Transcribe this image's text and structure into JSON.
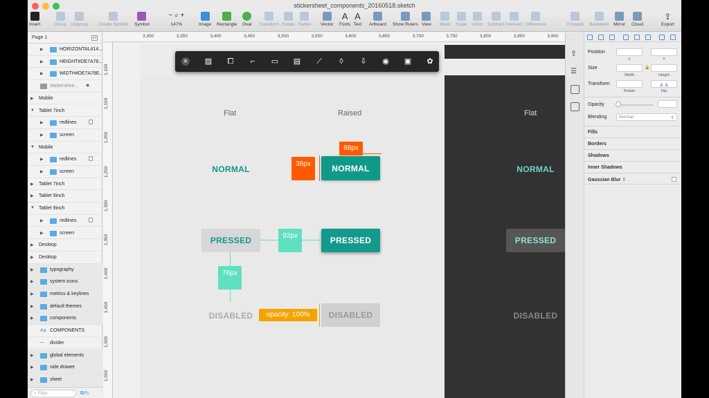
{
  "window": {
    "title": "stickersheet_components_20160518.sketch"
  },
  "toolbar": [
    {
      "id": "insert",
      "label": "Insert",
      "icon": "plus-icon"
    },
    {
      "id": "group",
      "label": "Group",
      "icon": "group-icon"
    },
    {
      "id": "ungroup",
      "label": "Ungroup",
      "icon": "ungroup-icon"
    },
    {
      "id": "create-symbol",
      "label": "Create Symbol",
      "icon": "symbol-create-icon"
    },
    {
      "id": "symbol",
      "label": "Symbol",
      "icon": "symbol-icon"
    },
    {
      "id": "zoom",
      "label": "147%",
      "icon": "zoom-icon"
    },
    {
      "id": "image",
      "label": "Image",
      "icon": "image-icon"
    },
    {
      "id": "rectangle",
      "label": "Rectangle",
      "icon": "rectangle-icon"
    },
    {
      "id": "oval",
      "label": "Oval",
      "icon": "oval-icon"
    },
    {
      "id": "transform",
      "label": "Transform",
      "icon": "transform-icon"
    },
    {
      "id": "rotate",
      "label": "Rotate",
      "icon": "rotate-icon"
    },
    {
      "id": "flatten",
      "label": "Flatten",
      "icon": "flatten-icon"
    },
    {
      "id": "vector",
      "label": "Vector",
      "icon": "pen-icon"
    },
    {
      "id": "fonts",
      "label": "Fonts",
      "icon": "fonts-icon"
    },
    {
      "id": "text",
      "label": "Text",
      "icon": "text-icon"
    },
    {
      "id": "artboard",
      "label": "Artboard",
      "icon": "artboard-icon"
    },
    {
      "id": "show-rulers",
      "label": "Show Rulers",
      "icon": "rulers-icon"
    },
    {
      "id": "view",
      "label": "View",
      "icon": "view-icon"
    },
    {
      "id": "mask",
      "label": "Mask",
      "icon": "mask-icon"
    },
    {
      "id": "scale",
      "label": "Scale",
      "icon": "scale-icon"
    },
    {
      "id": "union",
      "label": "Union",
      "icon": "union-icon"
    },
    {
      "id": "subtract",
      "label": "Subtract",
      "icon": "subtract-icon"
    },
    {
      "id": "intersect",
      "label": "Intersect",
      "icon": "intersect-icon"
    },
    {
      "id": "difference",
      "label": "Difference",
      "icon": "difference-icon"
    },
    {
      "id": "forward",
      "label": "Forward",
      "icon": "forward-icon"
    },
    {
      "id": "backward",
      "label": "Backward",
      "icon": "backward-icon"
    },
    {
      "id": "mirror",
      "label": "Mirror",
      "icon": "mirror-icon"
    },
    {
      "id": "cloud",
      "label": "Cloud",
      "icon": "cloud-icon"
    },
    {
      "id": "export",
      "label": "Export",
      "icon": "export-icon"
    }
  ],
  "pages": {
    "label": "Page 1"
  },
  "layers": [
    {
      "label": "HORIZONTAL#14...",
      "type": "folder",
      "indent": 1
    },
    {
      "label": "HEIGHT#DE7A78...",
      "type": "folder",
      "indent": 1
    },
    {
      "label": "WIDTH#DE7A78E...",
      "type": "folder",
      "indent": 1
    },
    {
      "label": "stickershee...",
      "type": "image",
      "indent": 1,
      "eye": true
    },
    {
      "label": "Mobile",
      "type": "group",
      "indent": 0
    },
    {
      "label": "Tablet 7inch",
      "type": "group",
      "indent": 0,
      "open": true
    },
    {
      "label": "redlines",
      "type": "folder",
      "indent": 1,
      "lock": true
    },
    {
      "label": "screen",
      "type": "folder",
      "indent": 1
    },
    {
      "label": "Mobile",
      "type": "group",
      "indent": 0,
      "open": true
    },
    {
      "label": "redlines",
      "type": "folder",
      "indent": 1,
      "lock": true
    },
    {
      "label": "screen",
      "type": "folder",
      "indent": 1
    },
    {
      "label": "Tablet 7inch",
      "type": "group",
      "indent": 0
    },
    {
      "label": "Tablet 9inch",
      "type": "group",
      "indent": 0
    },
    {
      "label": "Tablet 9inch",
      "type": "group",
      "indent": 0,
      "open": true
    },
    {
      "label": "redlines",
      "type": "folder",
      "indent": 1,
      "lock": true
    },
    {
      "label": "screen",
      "type": "folder",
      "indent": 1
    },
    {
      "label": "Desktop",
      "type": "group",
      "indent": 0
    },
    {
      "label": "Desktop",
      "type": "group",
      "indent": 0
    },
    {
      "label": "typography",
      "type": "folder",
      "indent": 0
    },
    {
      "label": "system icons",
      "type": "folder",
      "indent": 0
    },
    {
      "label": "metrics & keylines",
      "type": "folder",
      "indent": 0
    },
    {
      "label": "default themes",
      "type": "folder",
      "indent": 0
    },
    {
      "label": "components",
      "type": "folder",
      "indent": 0
    },
    {
      "label": "COMPONENTS",
      "type": "text",
      "indent": 0
    },
    {
      "label": "divider",
      "type": "line",
      "indent": 0
    },
    {
      "label": "global elements",
      "type": "folder",
      "indent": 0
    },
    {
      "label": "side drawer",
      "type": "folder",
      "indent": 0
    },
    {
      "label": "sheet",
      "type": "folder",
      "indent": 0
    }
  ],
  "filter": {
    "placeholder": "Filter"
  },
  "ruler_top": [
    "3,300",
    "3,350",
    "3,400",
    "3,450",
    "3,500",
    "3,550",
    "3,600",
    "3,650",
    "3,700",
    "3,750",
    "3,800",
    "3,850",
    "3,900"
  ],
  "ruler_left": [
    "1,100",
    "1,150",
    "1,200",
    "1,250",
    "1,300",
    "1,350",
    "1,400",
    "1,450",
    "1,500",
    "1,550"
  ],
  "artboard": {
    "col_flat": "Flat",
    "col_raised": "Raised",
    "col_flat_dark": "Flat",
    "normal_flat": "NORMAL",
    "normal_raised": "NORMAL",
    "normal_dark": "NORMAL",
    "pressed_flat": "PRESSED",
    "pressed_raised": "PRESSED",
    "pressed_dark": "PRESSED",
    "disabled_flat": "DISABLED",
    "disabled_raised": "DISABLED",
    "disabled_dark": "DISABLED",
    "m_88": "88px",
    "m_36": "36px",
    "m_92": "92px",
    "m_76": "76px",
    "m_opacity": "opacity: 100%"
  },
  "float_toolbar": [
    "close-icon",
    "pattern-icon",
    "crop-icon",
    "anchor-icon",
    "comment-icon",
    "list-icon",
    "brush-icon",
    "drop-icon",
    "download-icon",
    "eye-icon",
    "lock-icon",
    "settings-icon"
  ],
  "inspector": {
    "position": "Position",
    "x": "X",
    "y": "Y",
    "size": "Size",
    "width": "Width",
    "height": "Height",
    "transform": "Transform",
    "rotate": "Rotate",
    "flip": "Flip",
    "opacity": "Opacity",
    "blending": "Blending",
    "blending_value": "Normal",
    "fills": "Fills",
    "borders": "Borders",
    "shadows": "Shadows",
    "inner_shadows": "Inner Shadows",
    "gaussian_blur": "Gaussian Blur"
  },
  "colors": {
    "teal": "#119988",
    "teal_light": "#6fd5c8",
    "orange": "#ff5a00",
    "mint": "#5fe0c0",
    "dark": "#323232",
    "folder": "#5aabdf"
  }
}
